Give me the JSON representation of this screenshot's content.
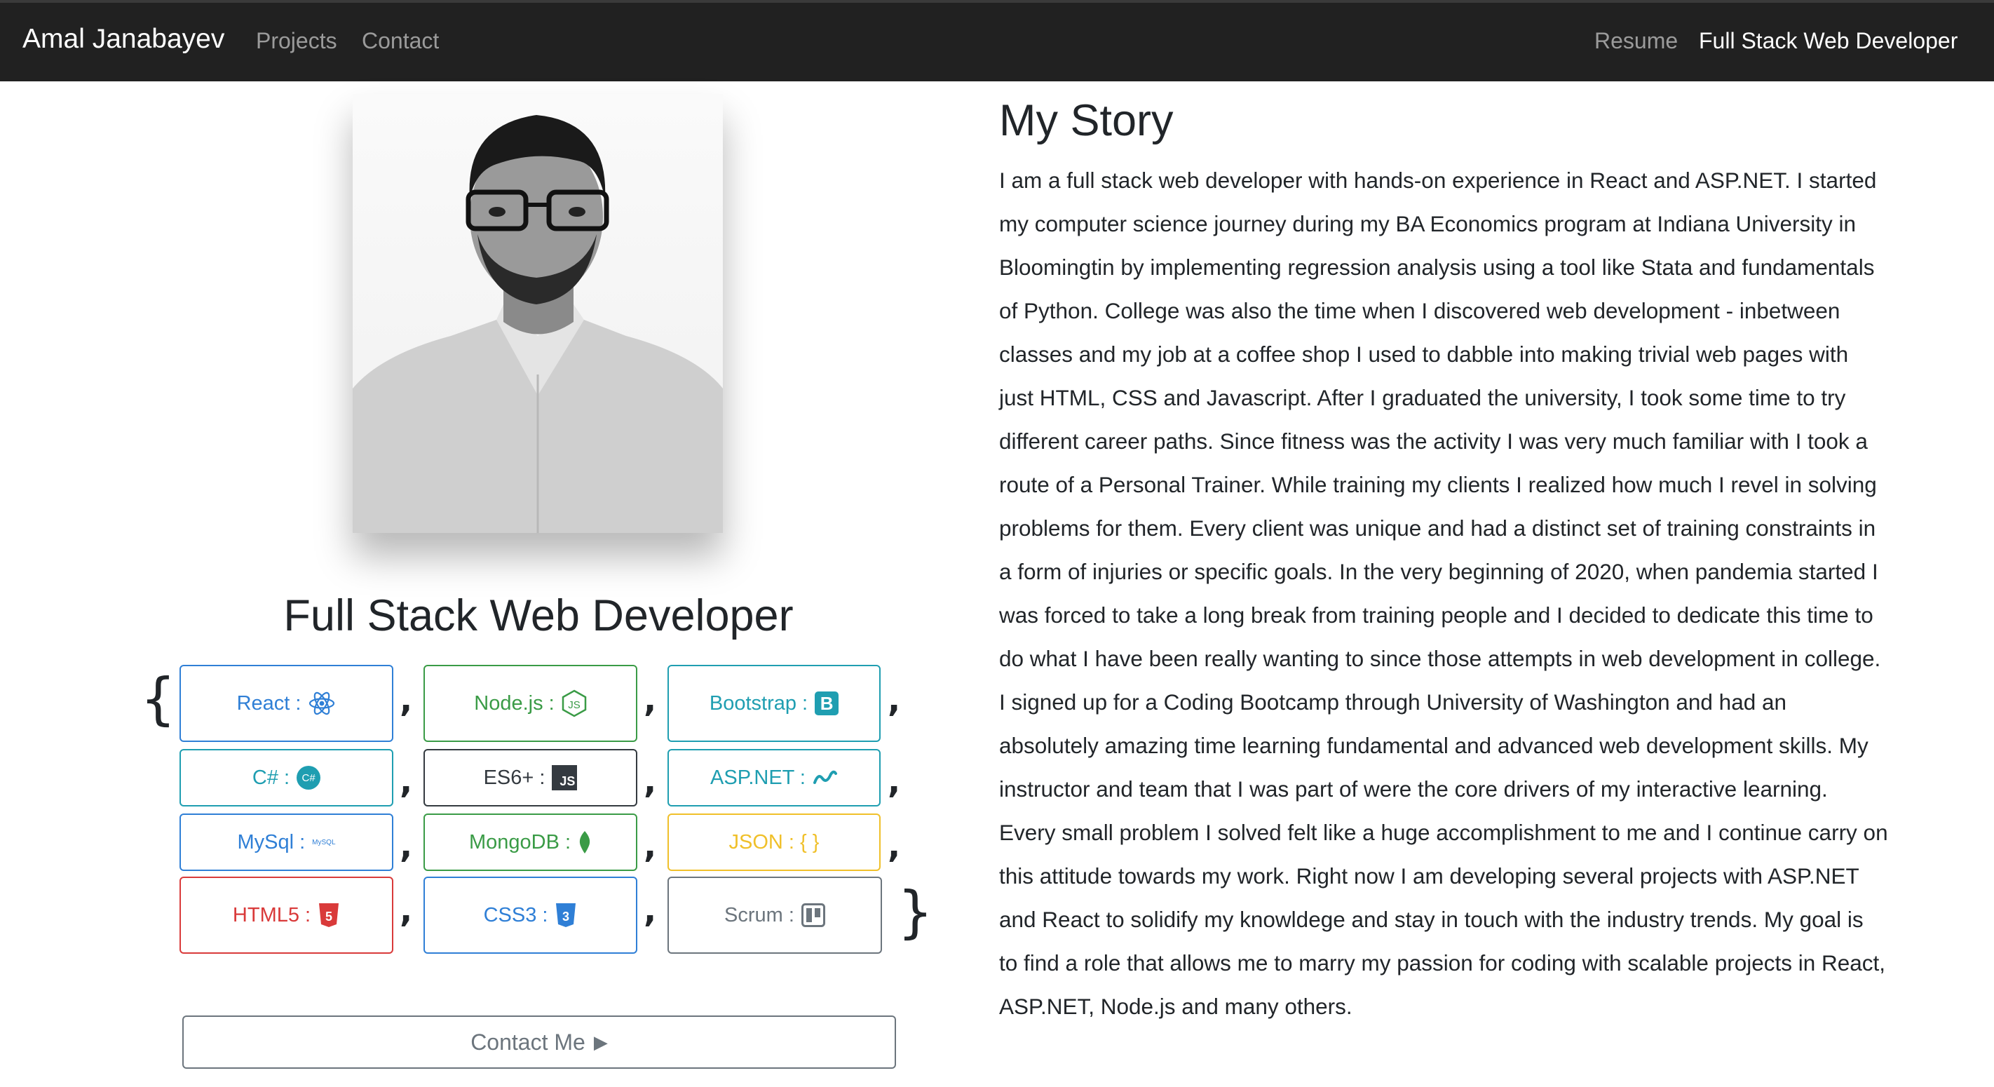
{
  "navbar": {
    "brand": "Amal Janabayev",
    "links": [
      "Projects",
      "Contact"
    ],
    "right_links": [
      "Resume",
      "Full Stack Web Developer"
    ]
  },
  "hero": {
    "title": "Full Stack Web Developer",
    "open_brace": "{",
    "close_brace": "}",
    "separator": ","
  },
  "skills": [
    {
      "label": "React :",
      "color": "#2f7fd6",
      "icon": "react-icon"
    },
    {
      "label": "Node.js :",
      "color": "#3a9b46",
      "icon": "nodejs-icon"
    },
    {
      "label": "Bootstrap :",
      "color": "#1f9eb1",
      "icon": "bootstrap-icon",
      "icon_text": "B"
    },
    {
      "label": "C# :",
      "color": "#1f9eb1",
      "icon": "csharp-icon",
      "icon_text": "C#"
    },
    {
      "label": "ES6+ :",
      "color": "#343a40",
      "icon": "javascript-icon",
      "icon_text": "JS"
    },
    {
      "label": "ASP.NET :",
      "color": "#1f9eb1",
      "icon": "aspnet-icon"
    },
    {
      "label": "MySql :",
      "color": "#2f7fd6",
      "icon": "mysql-icon",
      "icon_text": "MySQL"
    },
    {
      "label": "MongoDB :",
      "color": "#3a9b46",
      "icon": "mongodb-leaf-icon"
    },
    {
      "label": "JSON : { }",
      "color": "#f0c02a",
      "icon": "json-braces"
    },
    {
      "label": "HTML5 :",
      "color": "#d93a3a",
      "icon": "html5-icon",
      "icon_text": "5"
    },
    {
      "label": "CSS3 :",
      "color": "#2f7fd6",
      "icon": "css3-icon",
      "icon_text": "3"
    },
    {
      "label": "Scrum :",
      "color": "#6c757d",
      "icon": "trello-board-icon"
    }
  ],
  "contact_button": {
    "label": "Contact Me",
    "arrow": "▶"
  },
  "story": {
    "title": "My Story",
    "lines": [
      "I am a full stack web developer with hands-on experience in React and ASP.NET. I started",
      "my computer science journey during my BA Economics program at Indiana University in",
      "Bloomingtin by implementing regression analysis using a tool like Stata and fundamentals",
      "of Python. College was also the time when I discovered web development - inbetween",
      "classes and my job at a coffee shop I used to dabble into making trivial web pages with",
      "just HTML, CSS and Javascript. After I graduated the university, I took some time to try",
      "different career paths. Since fitness was the activity I was very much familiar with I took a",
      "route of a Personal Trainer. While training my clients I realized how much I revel in solving",
      "problems for them. Every client was unique and had a distinct set of training constraints in",
      "a form of injuries or specific goals. In the very beginning of 2020, when pandemia started I",
      "was forced to take a long break from training people and I decided to dedicate this time to",
      "do what I have been really wanting to since those attempts in web development in college.",
      "I signed up for a Coding Bootcamp through University of Washington and had an",
      "absolutely amazing time learning fundamental and advanced web development skills. My",
      "instructor and team that I was part of were the core drivers of my interactive learning.",
      "Every small problem I solved felt like a huge accomplishment to me and I continue carry on",
      "this attitude towards my work. Right now I am developing several projects with ASP.NET",
      "and React to solidify my knowldege and stay in touch with the industry trends. My goal is",
      "to find a role that allows me to marry my passion for coding with scalable projects in React,",
      "ASP.NET, Node.js and many others."
    ]
  }
}
